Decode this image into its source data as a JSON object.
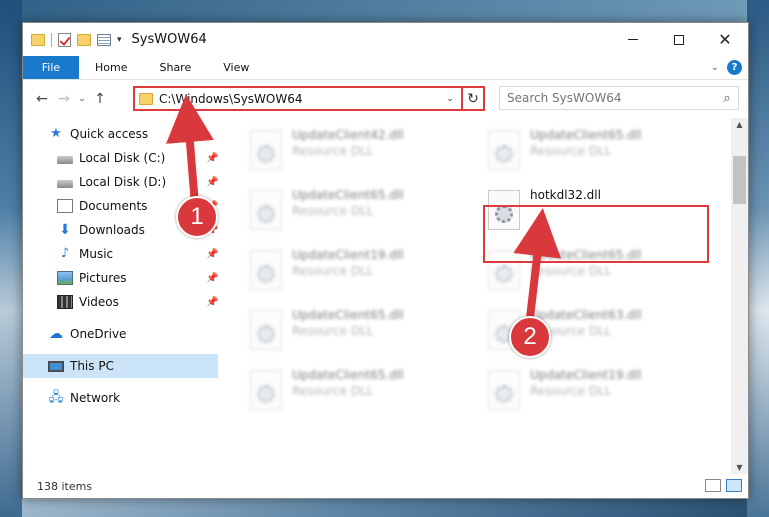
{
  "window": {
    "title": "SysWOW64"
  },
  "ribbon": {
    "tabs": [
      {
        "label": "File",
        "active": true
      },
      {
        "label": "Home"
      },
      {
        "label": "Share"
      },
      {
        "label": "View"
      }
    ],
    "help_label": "?"
  },
  "address_bar": {
    "path": "C:\\Windows\\SysWOW64"
  },
  "search": {
    "placeholder": "Search SysWOW64"
  },
  "sidebar": {
    "items": [
      {
        "label": "Quick access",
        "icon": "star-icon"
      },
      {
        "label": "Local Disk (C:)",
        "icon": "drive-icon",
        "pinned": true
      },
      {
        "label": "Local Disk (D:)",
        "icon": "drive-icon",
        "pinned": true
      },
      {
        "label": "Documents",
        "icon": "documents-icon",
        "pinned": true
      },
      {
        "label": "Downloads",
        "icon": "download-icon",
        "pinned": true
      },
      {
        "label": "Music",
        "icon": "music-icon",
        "pinned": true
      },
      {
        "label": "Pictures",
        "icon": "pictures-icon",
        "pinned": true
      },
      {
        "label": "Videos",
        "icon": "videos-icon",
        "pinned": true
      },
      {
        "label": "OneDrive",
        "icon": "cloud-icon"
      },
      {
        "label": "This PC",
        "icon": "computer-icon",
        "selected": true
      },
      {
        "label": "Network",
        "icon": "network-icon"
      }
    ]
  },
  "files": [
    {
      "name": "UpdateClient42.dll",
      "type": "Resource DLL",
      "blurred": true
    },
    {
      "name": "UpdateClient65.dll",
      "type": "Resource DLL",
      "blurred": true
    },
    {
      "name": "UpdateClient65.dll",
      "type": "Resource DLL",
      "blurred": true
    },
    {
      "name": "hotkdl32.dll",
      "type": "",
      "blurred": false
    },
    {
      "name": "UpdateClient19.dll",
      "type": "Resource DLL",
      "blurred": true
    },
    {
      "name": "UpdateClient65.dll",
      "type": "Resource DLL",
      "blurred": true
    },
    {
      "name": "UpdateClient65.dll",
      "type": "Resource DLL",
      "blurred": true
    },
    {
      "name": "UpdateClient63.dll",
      "type": "Resource DLL",
      "blurred": true
    },
    {
      "name": "UpdateClient65.dll",
      "type": "Resource DLL",
      "blurred": true
    },
    {
      "name": "UpdateClient19.dll",
      "type": "Resource DLL",
      "blurred": true
    }
  ],
  "status": {
    "item_count": "138 items"
  },
  "annotations": {
    "step1": "1",
    "step2": "2"
  },
  "colors": {
    "accent": "#1979ca",
    "annotation_red": "#d9383c",
    "selection": "#cce4f7"
  }
}
